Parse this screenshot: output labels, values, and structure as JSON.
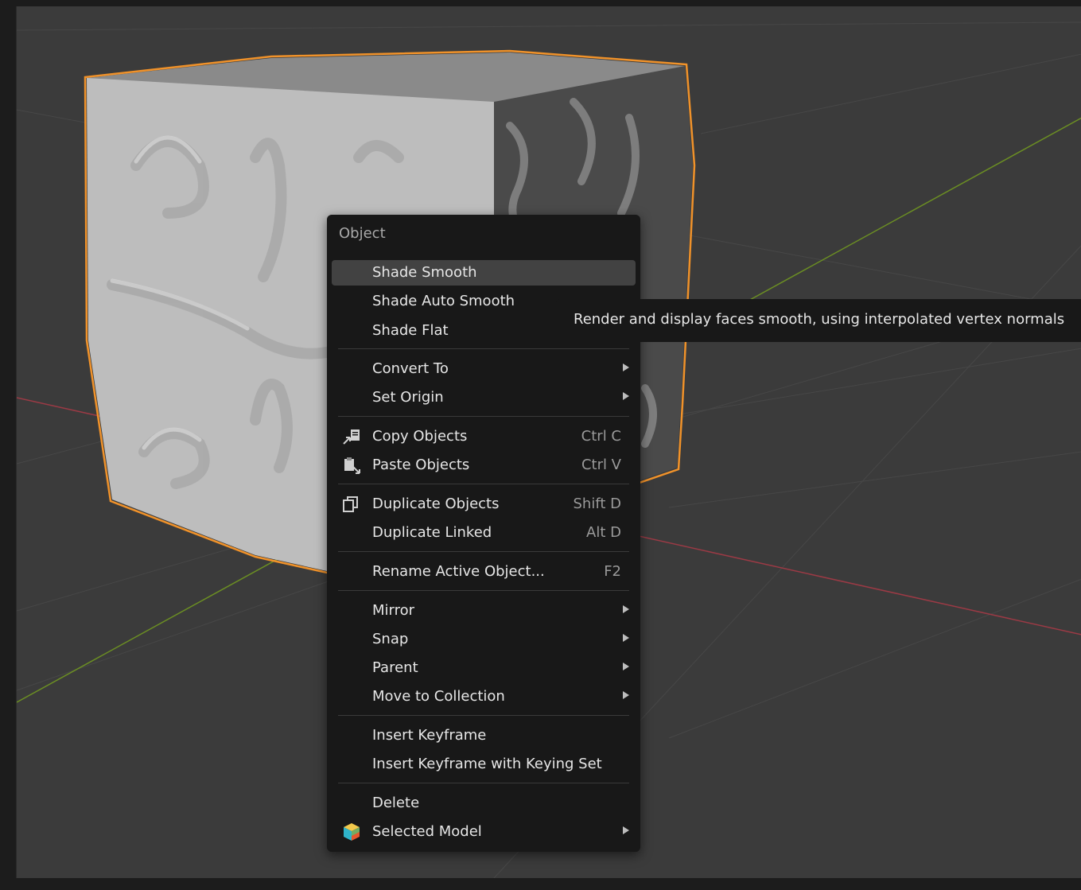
{
  "context_menu": {
    "title": "Object",
    "items": [
      {
        "label": "Shade Smooth",
        "shortcut": "",
        "submenu": false
      },
      {
        "label": "Shade Auto Smooth",
        "shortcut": "",
        "submenu": false
      },
      {
        "label": "Shade Flat",
        "shortcut": "",
        "submenu": false
      },
      {
        "label": "Convert To",
        "shortcut": "",
        "submenu": true
      },
      {
        "label": "Set Origin",
        "shortcut": "",
        "submenu": true
      },
      {
        "label": "Copy Objects",
        "shortcut": "Ctrl C",
        "submenu": false,
        "icon": "copy-objects-icon"
      },
      {
        "label": "Paste Objects",
        "shortcut": "Ctrl V",
        "submenu": false,
        "icon": "paste-objects-icon"
      },
      {
        "label": "Duplicate Objects",
        "shortcut": "Shift D",
        "submenu": false,
        "icon": "duplicate-icon"
      },
      {
        "label": "Duplicate Linked",
        "shortcut": "Alt D",
        "submenu": false
      },
      {
        "label": "Rename Active Object...",
        "shortcut": "F2",
        "submenu": false
      },
      {
        "label": "Mirror",
        "shortcut": "",
        "submenu": true
      },
      {
        "label": "Snap",
        "shortcut": "",
        "submenu": true
      },
      {
        "label": "Parent",
        "shortcut": "",
        "submenu": true
      },
      {
        "label": "Move to Collection",
        "shortcut": "",
        "submenu": true
      },
      {
        "label": "Insert Keyframe",
        "shortcut": "",
        "submenu": false
      },
      {
        "label": "Insert Keyframe with Keying Set",
        "shortcut": "",
        "submenu": false
      },
      {
        "label": "Delete",
        "shortcut": "",
        "submenu": false
      },
      {
        "label": "Selected Model",
        "shortcut": "",
        "submenu": true,
        "icon": "addon-cube-icon"
      }
    ],
    "highlighted_item": "Shade Smooth"
  },
  "tooltip": {
    "text": "Render and display faces smooth, using interpolated vertex normals"
  },
  "colors": {
    "viewport_bg": "#3b3b3b",
    "menu_bg": "#181818",
    "highlight": "#424242",
    "selection_outline": "#f0922a",
    "x_axis": "#9b3a45",
    "y_axis": "#6b8e23"
  }
}
